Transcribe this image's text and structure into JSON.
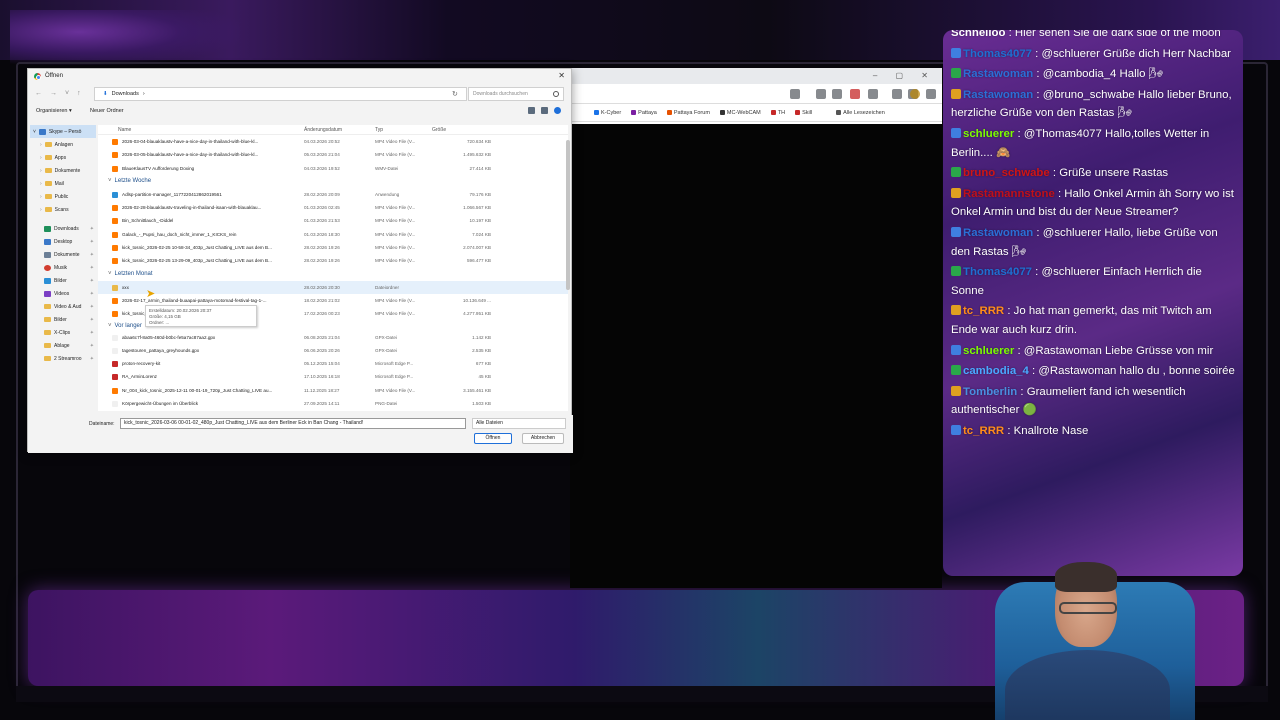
{
  "dialog": {
    "title": "Öffnen",
    "close": "✕",
    "path": "Downloads",
    "search_placeholder": "Downloads durchsuchen",
    "organize": "Organisieren ▾",
    "new_folder": "Neuer Ordner",
    "columns": {
      "name": "Name",
      "date": "Änderungsdatum",
      "type": "Typ",
      "size": "Größe"
    },
    "sidebar": [
      {
        "label": "Skype – Persö"
      },
      {
        "label": "Anlagen"
      },
      {
        "label": "Apps"
      },
      {
        "label": "Dokumente"
      },
      {
        "label": "Mail"
      },
      {
        "label": "Public"
      },
      {
        "label": "Scans"
      },
      {
        "label": "Downloads"
      },
      {
        "label": "Desktop"
      },
      {
        "label": "Dokumente"
      },
      {
        "label": "Musik"
      },
      {
        "label": "Bilder"
      },
      {
        "label": "Videos"
      },
      {
        "label": "Video & Aud"
      },
      {
        "label": "Bilder"
      },
      {
        "label": "X-Clips"
      },
      {
        "label": "Ablage"
      },
      {
        "label": "2 Streamroo"
      }
    ],
    "groups": {
      "last_week": "Letzte Woche",
      "last_month": "Letzten Monat",
      "longer_ago": "Vor langer"
    },
    "files_top": [
      {
        "name": "2026-03-04-blauaklaustv-have-a-nice-day-in-thailand-with-blue-kl...",
        "date": "04.03.2026 20:52",
        "type": "MP4 Video File (V...",
        "size": "720.634 KB"
      },
      {
        "name": "2026-03-05-blauaklaustv-have-a-nice-day-in-thailand-with-blue-kl...",
        "date": "05.03.2026 21:04",
        "type": "MP4 Video File (V...",
        "size": "1.495.632 KB"
      },
      {
        "name": "BlaueKlausTV Aufforderung Doxing",
        "date": "04.03.2026 19:52",
        "type": "WMV-Datei",
        "size": "27.414 KB"
      }
    ],
    "files_week": [
      {
        "name": "Adlsp-partition-manager_1177220412862019561",
        "date": "28.02.2026 20:09",
        "type": "Anwendung",
        "size": "79.176 KB"
      },
      {
        "name": "2026-02-28-blauaklaustv-traveling-in-thailand-isaan-with-blauaklau...",
        "date": "01.03.2026 02:45",
        "type": "MP4 Video File (V...",
        "size": "1.066.567 KB"
      },
      {
        "name": "Bin_Schnittlauch_-Diddel",
        "date": "01.03.2026 21:53",
        "type": "MP4 Video File (V...",
        "size": "10.197 KB"
      },
      {
        "name": "Galack_-_Pupsi_hau_doch_nicht_immer_1_KICKS_rein",
        "date": "01.03.2026 18:30",
        "type": "MP4 Video File (V...",
        "size": "7.024 KB"
      },
      {
        "name": "kick_tosnic_2026-02-25 10-58-34_403p_Just Chatting_LIVE aus dem B...",
        "date": "28.02.2026 19:26",
        "type": "MP4 Video File (V...",
        "size": "2.074.007 KB"
      },
      {
        "name": "kick_tosnic_2026-02-25 13-29-09_403p_Just Chatting_LIVE aus dem B...",
        "date": "28.02.2026 19:26",
        "type": "MP4 Video File (V...",
        "size": "596.477 KB"
      }
    ],
    "files_month": [
      {
        "name": "xxx",
        "date": "28.02.2026 20:30",
        "type": "Dateiordner",
        "size": ""
      },
      {
        "name": "2026-02-17_armin_thailand-buaapai-pattaya-motomad-festival-tag-1-...",
        "date": "18.02.2026 21:02",
        "type": "MP4 Video File (V...",
        "size": "10.136.649 ..."
      },
      {
        "name": "kick_tosnic_2026-02-10 ... Just Chatting_LIVE aus dem B...",
        "date": "17.02.2026 00:23",
        "type": "MP4 Video File (V...",
        "size": "4.277.951 KB"
      }
    ],
    "files_old": [
      {
        "name": "abaa6c7f-8a05-460d-b0bc-fe5a7ac87aa2.gpx",
        "date": "06.08.2025 21:04",
        "type": "GPX-Datei",
        "size": "1.142 KB"
      },
      {
        "name": "tagestouren_pattaya_greyhounds.gpx",
        "date": "06.06.2025 20:26",
        "type": "GPX-Datei",
        "size": "2.535 KB"
      },
      {
        "name": "proton-recovery-kit",
        "date": "05.12.2025 15:04",
        "type": "Microsoft Edge P...",
        "size": "677 KB"
      },
      {
        "name": "RA_ArminLorenz",
        "date": "17.10.2025 16:18",
        "type": "Microsoft Edge P...",
        "size": "45 KB"
      },
      {
        "name": "Nr_004_kick_tosnic_2025-12-11 00-01-19_720p_Just Chatting_LIVE au...",
        "date": "11.12.2025 18:27",
        "type": "MP4 Video File (V...",
        "size": "3.155.461 KB"
      },
      {
        "name": "Körpergewicht-Übungen im Überblick",
        "date": "27.09.2025 14:11",
        "type": "PNG-Datei",
        "size": "1.503 KB"
      }
    ],
    "tooltip": [
      "Erstelldatum: 20.02.2026 20:37",
      "Größe: 4,15 GB",
      "Ordner: ..."
    ],
    "filename_label": "Dateiname:",
    "filename_value": "kick_tosnic_2026-03-06 00-01-02_480p_Just Chatting_LIVE aus dem Berliner Eck in Ban Chang - Thailand!",
    "filter": "Alle Dateien",
    "open_button": "Öffnen",
    "cancel_button": "Abbrechen"
  },
  "browser": {
    "bookmarks": [
      "K-Cyber",
      "Pattaya",
      "Pattaya Forum",
      "MC-WebCAM",
      "TH",
      "Skill",
      "Alle Lesezeichen"
    ],
    "bookmark_colors": [
      "#1a73e8",
      "#7b1fa2",
      "#e65100",
      "#333333",
      "#c62828",
      "#c62828",
      "#555555"
    ]
  },
  "chat": [
    {
      "user": "Schnelloo",
      "color": "#ffffff",
      "text": " : Hier sehen Sie die dark side of the moon"
    },
    {
      "user": "Thomas4077",
      "color": "#1f6fd1",
      "text": " : @schluerer Grüße dich Herr Nachbar"
    },
    {
      "user": "Rastawoman",
      "color": "#2b6fd6",
      "text": " : @cambodia_4 Hallo 🌬"
    },
    {
      "user": "Rastawoman",
      "color": "#2b6fd6",
      "text": " : @bruno_schwabe Hallo lieber Bruno, herzliche Grüße von den Rastas 🌬"
    },
    {
      "user": "schluerer",
      "color": "#7cfc00",
      "text": " : @Thomas4077 Hallo,tolles Wetter in Berlin.... 🙈"
    },
    {
      "user": "bruno_schwabe",
      "color": "#d01515",
      "text": " : Grüße unsere Rastas"
    },
    {
      "user": "Rastamannstone",
      "color": "#c0101a",
      "text": " : Hallo Onkel Armin äh Sorry wo ist Onkel Armin und bist du der Neue Streamer?"
    },
    {
      "user": "Rastawoman",
      "color": "#2b6fd6",
      "text": " : @schluerer Hallo, liebe Grüße von den Rastas 🌬"
    },
    {
      "user": "Thomas4077",
      "color": "#1f6fd1",
      "text": " : @schluerer Einfach Herrlich die Sonne"
    },
    {
      "user": "tc_RRR",
      "color": "#ff8c1a",
      "text": " : Jo hat man gemerkt, das mit Twitch am Ende war auch kurz drin."
    },
    {
      "user": "schluerer",
      "color": "#7cfc00",
      "text": " : @Rastawoman Liebe Grüsse von mir"
    },
    {
      "user": "cambodia_4",
      "color": "#4aa8ff",
      "text": " : @Rastawoman hallo du , bonne soirée"
    },
    {
      "user": "Tomberlin",
      "color": "#4a8fe0",
      "text": " : Graumeliert fand ich wesentlich authentischer 🟢"
    },
    {
      "user": "tc_RRR",
      "color": "#ff8c1a",
      "text": " : Knallrote Nase"
    }
  ]
}
